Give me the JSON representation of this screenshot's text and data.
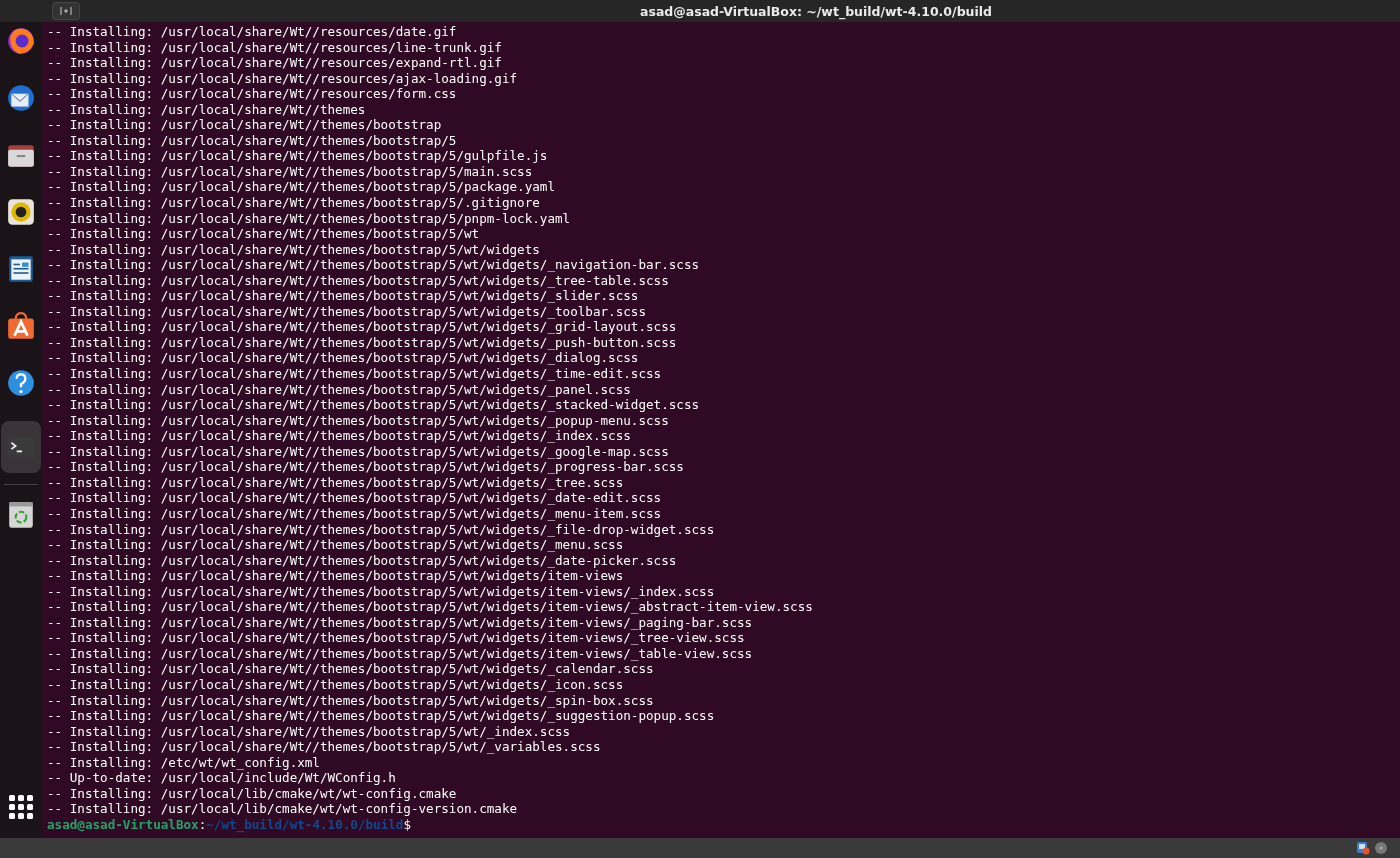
{
  "window": {
    "title": "asad@asad-VirtualBox: ~/wt_build/wt-4.10.0/build"
  },
  "dock": {
    "items": [
      {
        "kind": "firefox",
        "selected": false
      },
      {
        "kind": "mail",
        "selected": false
      },
      {
        "kind": "files",
        "selected": false
      },
      {
        "kind": "music",
        "selected": false
      },
      {
        "kind": "writer",
        "selected": false
      },
      {
        "kind": "store",
        "selected": false
      },
      {
        "kind": "help",
        "selected": false
      },
      {
        "kind": "terminal",
        "selected": true
      },
      {
        "kind": "trash",
        "selected": false
      }
    ]
  },
  "terminal": {
    "lines": [
      "-- Installing: /usr/local/share/Wt//resources/date.gif",
      "-- Installing: /usr/local/share/Wt//resources/line-trunk.gif",
      "-- Installing: /usr/local/share/Wt//resources/expand-rtl.gif",
      "-- Installing: /usr/local/share/Wt//resources/ajax-loading.gif",
      "-- Installing: /usr/local/share/Wt//resources/form.css",
      "-- Installing: /usr/local/share/Wt//themes",
      "-- Installing: /usr/local/share/Wt//themes/bootstrap",
      "-- Installing: /usr/local/share/Wt//themes/bootstrap/5",
      "-- Installing: /usr/local/share/Wt//themes/bootstrap/5/gulpfile.js",
      "-- Installing: /usr/local/share/Wt//themes/bootstrap/5/main.scss",
      "-- Installing: /usr/local/share/Wt//themes/bootstrap/5/package.yaml",
      "-- Installing: /usr/local/share/Wt//themes/bootstrap/5/.gitignore",
      "-- Installing: /usr/local/share/Wt//themes/bootstrap/5/pnpm-lock.yaml",
      "-- Installing: /usr/local/share/Wt//themes/bootstrap/5/wt",
      "-- Installing: /usr/local/share/Wt//themes/bootstrap/5/wt/widgets",
      "-- Installing: /usr/local/share/Wt//themes/bootstrap/5/wt/widgets/_navigation-bar.scss",
      "-- Installing: /usr/local/share/Wt//themes/bootstrap/5/wt/widgets/_tree-table.scss",
      "-- Installing: /usr/local/share/Wt//themes/bootstrap/5/wt/widgets/_slider.scss",
      "-- Installing: /usr/local/share/Wt//themes/bootstrap/5/wt/widgets/_toolbar.scss",
      "-- Installing: /usr/local/share/Wt//themes/bootstrap/5/wt/widgets/_grid-layout.scss",
      "-- Installing: /usr/local/share/Wt//themes/bootstrap/5/wt/widgets/_push-button.scss",
      "-- Installing: /usr/local/share/Wt//themes/bootstrap/5/wt/widgets/_dialog.scss",
      "-- Installing: /usr/local/share/Wt//themes/bootstrap/5/wt/widgets/_time-edit.scss",
      "-- Installing: /usr/local/share/Wt//themes/bootstrap/5/wt/widgets/_panel.scss",
      "-- Installing: /usr/local/share/Wt//themes/bootstrap/5/wt/widgets/_stacked-widget.scss",
      "-- Installing: /usr/local/share/Wt//themes/bootstrap/5/wt/widgets/_popup-menu.scss",
      "-- Installing: /usr/local/share/Wt//themes/bootstrap/5/wt/widgets/_index.scss",
      "-- Installing: /usr/local/share/Wt//themes/bootstrap/5/wt/widgets/_google-map.scss",
      "-- Installing: /usr/local/share/Wt//themes/bootstrap/5/wt/widgets/_progress-bar.scss",
      "-- Installing: /usr/local/share/Wt//themes/bootstrap/5/wt/widgets/_tree.scss",
      "-- Installing: /usr/local/share/Wt//themes/bootstrap/5/wt/widgets/_date-edit.scss",
      "-- Installing: /usr/local/share/Wt//themes/bootstrap/5/wt/widgets/_menu-item.scss",
      "-- Installing: /usr/local/share/Wt//themes/bootstrap/5/wt/widgets/_file-drop-widget.scss",
      "-- Installing: /usr/local/share/Wt//themes/bootstrap/5/wt/widgets/_menu.scss",
      "-- Installing: /usr/local/share/Wt//themes/bootstrap/5/wt/widgets/_date-picker.scss",
      "-- Installing: /usr/local/share/Wt//themes/bootstrap/5/wt/widgets/item-views",
      "-- Installing: /usr/local/share/Wt//themes/bootstrap/5/wt/widgets/item-views/_index.scss",
      "-- Installing: /usr/local/share/Wt//themes/bootstrap/5/wt/widgets/item-views/_abstract-item-view.scss",
      "-- Installing: /usr/local/share/Wt//themes/bootstrap/5/wt/widgets/item-views/_paging-bar.scss",
      "-- Installing: /usr/local/share/Wt//themes/bootstrap/5/wt/widgets/item-views/_tree-view.scss",
      "-- Installing: /usr/local/share/Wt//themes/bootstrap/5/wt/widgets/item-views/_table-view.scss",
      "-- Installing: /usr/local/share/Wt//themes/bootstrap/5/wt/widgets/_calendar.scss",
      "-- Installing: /usr/local/share/Wt//themes/bootstrap/5/wt/widgets/_icon.scss",
      "-- Installing: /usr/local/share/Wt//themes/bootstrap/5/wt/widgets/_spin-box.scss",
      "-- Installing: /usr/local/share/Wt//themes/bootstrap/5/wt/widgets/_suggestion-popup.scss",
      "-- Installing: /usr/local/share/Wt//themes/bootstrap/5/wt/_index.scss",
      "-- Installing: /usr/local/share/Wt//themes/bootstrap/5/wt/_variables.scss",
      "-- Installing: /etc/wt/wt_config.xml",
      "-- Up-to-date: /usr/local/include/Wt/WConfig.h",
      "-- Installing: /usr/local/lib/cmake/wt/wt-config.cmake",
      "-- Installing: /usr/local/lib/cmake/wt/wt-config-version.cmake"
    ],
    "prompt": {
      "user": "asad@asad-VirtualBox",
      "separator": ":",
      "path": "~/wt_build/wt-4.10.0/build",
      "symbol": "$"
    }
  }
}
